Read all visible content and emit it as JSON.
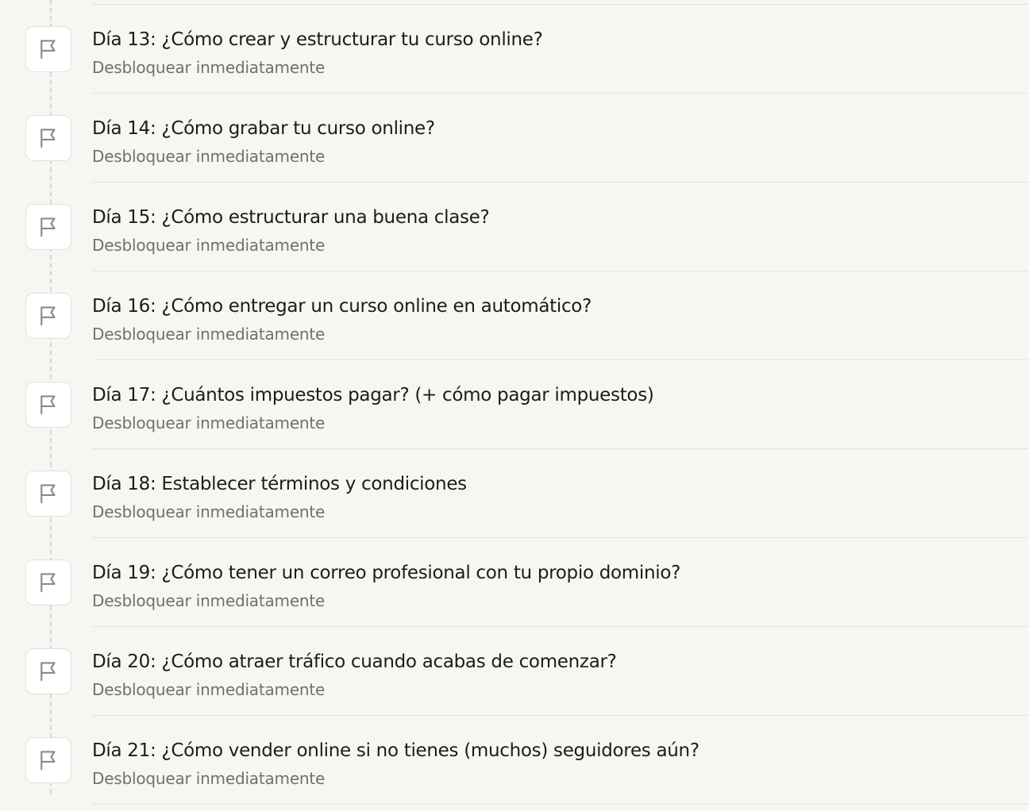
{
  "lessons": [
    {
      "title": "Día 13: ¿Cómo crear y estructurar tu curso online?",
      "status": "Desbloquear inmediatamente",
      "icon": "flag-icon"
    },
    {
      "title": "Día 14: ¿Cómo grabar tu curso online?",
      "status": "Desbloquear inmediatamente",
      "icon": "flag-icon"
    },
    {
      "title": "Día 15: ¿Cómo estructurar una buena clase?",
      "status": "Desbloquear inmediatamente",
      "icon": "flag-icon"
    },
    {
      "title": "Día 16: ¿Cómo entregar un curso online en automático?",
      "status": "Desbloquear inmediatamente",
      "icon": "flag-icon"
    },
    {
      "title": "Día 17: ¿Cuántos impuestos pagar? (+ cómo pagar impuestos)",
      "status": "Desbloquear inmediatamente",
      "icon": "flag-icon"
    },
    {
      "title": "Día 18: Establecer términos y condiciones",
      "status": "Desbloquear inmediatamente",
      "icon": "flag-icon"
    },
    {
      "title": "Día 19: ¿Cómo tener un correo profesional con tu propio dominio?",
      "status": "Desbloquear inmediatamente",
      "icon": "flag-icon"
    },
    {
      "title": "Día 20: ¿Cómo atraer tráfico cuando acabas de comenzar?",
      "status": "Desbloquear inmediatamente",
      "icon": "flag-icon"
    },
    {
      "title": "Día 21: ¿Cómo vender online si no tienes (muchos) seguidores aún?",
      "status": "Desbloquear inmediatamente",
      "icon": "flag-icon"
    }
  ],
  "colors": {
    "background": "#f7f6f3",
    "title": "#1c1c1c",
    "subtitle": "#707070",
    "divider": "#e4e2dd",
    "icon": "#8a8a8a"
  }
}
